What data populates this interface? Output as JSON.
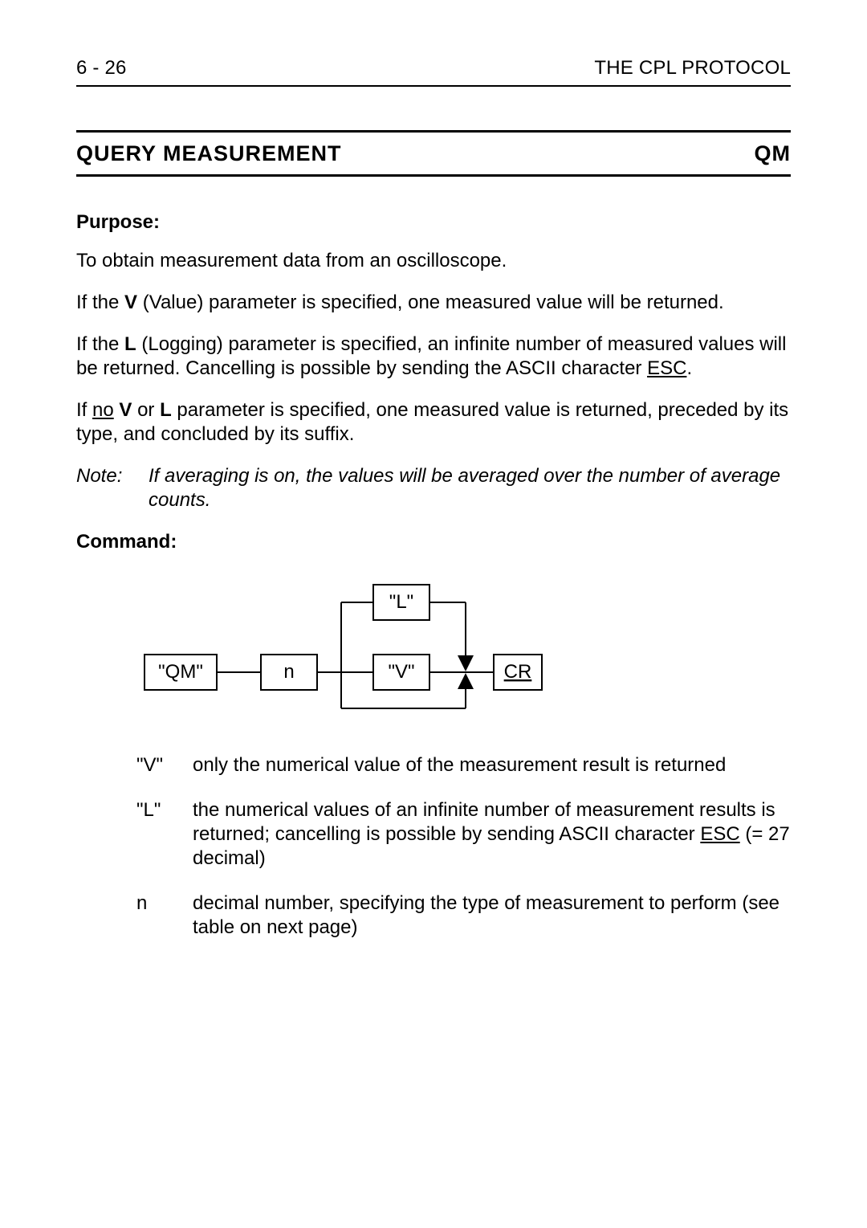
{
  "header": {
    "page_number": "6 - 26",
    "chapter_title": "THE CPL PROTOCOL"
  },
  "title": {
    "left": "QUERY MEASUREMENT",
    "right": "QM"
  },
  "purpose": {
    "label": "Purpose:",
    "p1": "To obtain measurement data from an oscilloscope.",
    "p2_pre": "If the ",
    "p2_bold": "V",
    "p2_post": " (Value) parameter is specified, one measured value will be returned.",
    "p3_pre": "If the ",
    "p3_bold": "L",
    "p3_mid": " (Logging) parameter is specified, an infinite number of measured values will be returned. Cancelling is possible by sending the ASCII character ",
    "p3_esc": "ESC",
    "p3_post": ".",
    "p4_pre": "If ",
    "p4_no": "no",
    "p4_sp1": " ",
    "p4_b1": "V",
    "p4_mid1": " or ",
    "p4_b2": "L",
    "p4_post": " parameter is specified, one measured value is returned, preceded by its type, and concluded by its suffix."
  },
  "note": {
    "label": "Note:",
    "text": "If averaging is on, the values will be averaged over the number of average counts."
  },
  "command": {
    "label": "Command:",
    "diagram": {
      "qm": "\"QM\"",
      "n": "n",
      "v": "\"V\"",
      "l": "\"L\"",
      "cr": "CR"
    },
    "defs": {
      "v_key": "\"V\"",
      "v_text": "only the numerical value of the measurement result is returned",
      "l_key": "\"L\"",
      "l_text_pre": "the numerical values of an infinite number of measurement results is returned; cancelling is possible by sending ASCII character ",
      "l_esc": "ESC",
      "l_text_post": " (= 27 decimal)",
      "n_key": "n",
      "n_text": "decimal number, specifying the type of measurement to perform (see table on next page)"
    }
  }
}
